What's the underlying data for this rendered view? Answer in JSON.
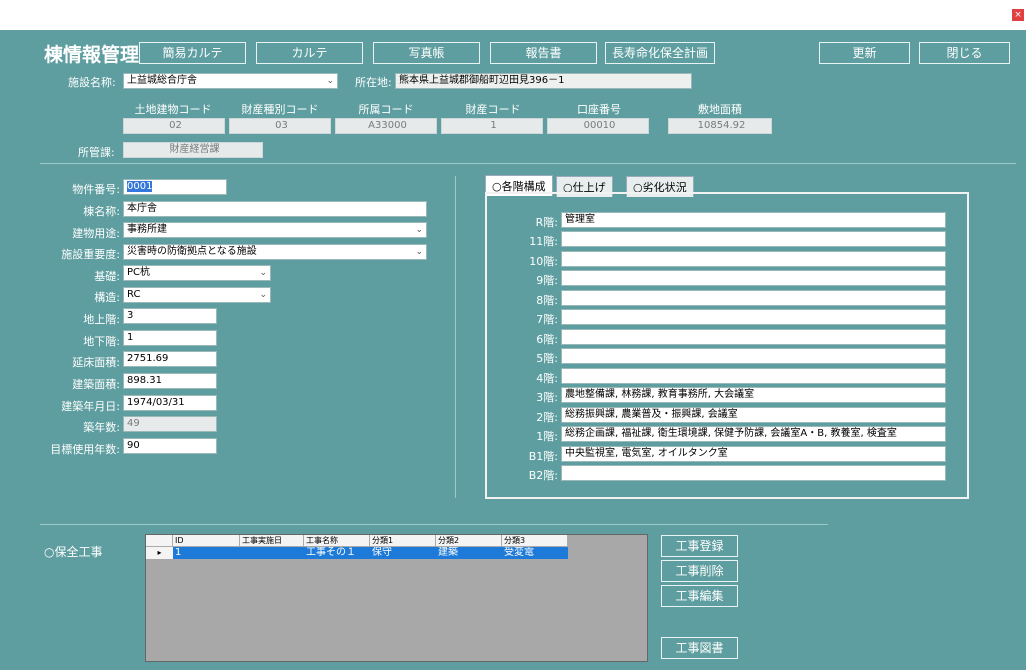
{
  "window": {
    "close_glyph": "×"
  },
  "header": {
    "title": "棟情報管理",
    "buttons": [
      "簡易カルテ",
      "カルテ",
      "写真帳",
      "報告書",
      "長寿命化保全計画"
    ],
    "update": "更新",
    "close": "閉じる"
  },
  "facility": {
    "name_label": "施設名称:",
    "name_value": "上益城総合庁舎",
    "location_label": "所在地:",
    "location_value": "熊本県上益城郡御船町辺田見396－1",
    "code_headers": [
      "土地建物コード",
      "財産種別コード",
      "所属コード",
      "財産コード",
      "口座番号",
      "敷地面積"
    ],
    "code_values": [
      "02",
      "03",
      "A33000",
      "1",
      "00010",
      "10854.92"
    ],
    "dept_label": "所管課:",
    "dept_value": "財産経営課"
  },
  "building": {
    "labels": [
      "物件番号:",
      "棟名称:",
      "建物用途:",
      "施設重要度:",
      "基礎:",
      "構造:",
      "地上階:",
      "地下階:",
      "延床面積:",
      "建築面積:",
      "建築年月日:",
      "築年数:",
      "目標使用年数:"
    ],
    "number": "0001",
    "name": "本庁舎",
    "use": "事務所建",
    "importance": "災害時の防衛拠点となる施設",
    "foundation": "PC杭",
    "structure": "RC",
    "floors_above": "3",
    "floors_below": "1",
    "total_floor_area": "2751.69",
    "building_area": "898.31",
    "built_date": "1974/03/31",
    "age": "49",
    "target_years": "90"
  },
  "tabs": [
    "○各階構成",
    "○仕上げ",
    "○劣化状況"
  ],
  "floors": {
    "labels": [
      "R階:",
      "11階:",
      "10階:",
      "9階:",
      "8階:",
      "7階:",
      "6階:",
      "5階:",
      "4階:",
      "3階:",
      "2階:",
      "1階:",
      "B1階:",
      "B2階:"
    ],
    "values": [
      "管理室",
      "",
      "",
      "",
      "",
      "",
      "",
      "",
      "",
      "農地整備課, 林務課, 教育事務所, 大会議室",
      "総務振興課, 農業普及・振興課, 会議室",
      "総務企画課, 福祉課, 衛生環境課, 保健予防課, 会議室A・B, 教養室, 検査室",
      "中央監視室, 電気室, オイルタンク室",
      ""
    ]
  },
  "maintenance": {
    "title": "○保全工事",
    "headers": [
      "ID",
      "工事実施日",
      "工事名称",
      "分類1",
      "分類2",
      "分類3"
    ],
    "rows": [
      [
        "1",
        "",
        "工事その１",
        "保守",
        "建築",
        "受変電"
      ]
    ],
    "row_marker": "▸",
    "buttons": [
      "工事登録",
      "工事削除",
      "工事編集",
      "工事図書"
    ]
  }
}
